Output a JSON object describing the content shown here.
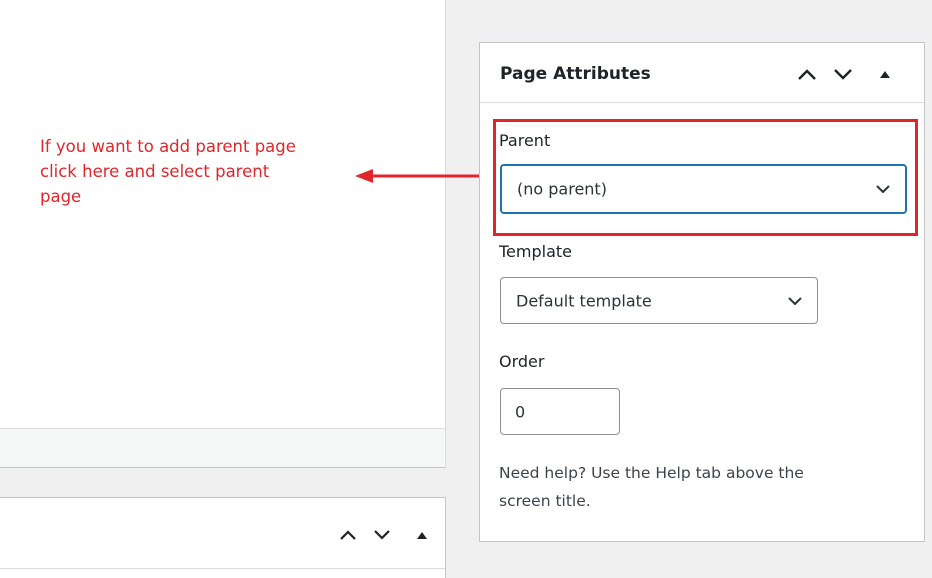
{
  "annotation": {
    "lines": [
      "If you want to add parent page",
      "click here and select parent",
      "page"
    ],
    "color": "#e0262b"
  },
  "panel": {
    "title": "Page Attributes",
    "controls": {
      "up_icon": "chevron-up-icon",
      "down_icon": "chevron-down-icon",
      "toggle_icon": "triangle-up-icon"
    },
    "parent": {
      "label": "Parent",
      "value": "(no parent)"
    },
    "template": {
      "label": "Template",
      "value": "Default template"
    },
    "order": {
      "label": "Order",
      "value": "0"
    },
    "help": {
      "line1": "Need help? Use the Help tab above the",
      "line2": "screen title."
    }
  },
  "colors": {
    "focus": "#2271b1",
    "highlight": "#e0262b"
  }
}
